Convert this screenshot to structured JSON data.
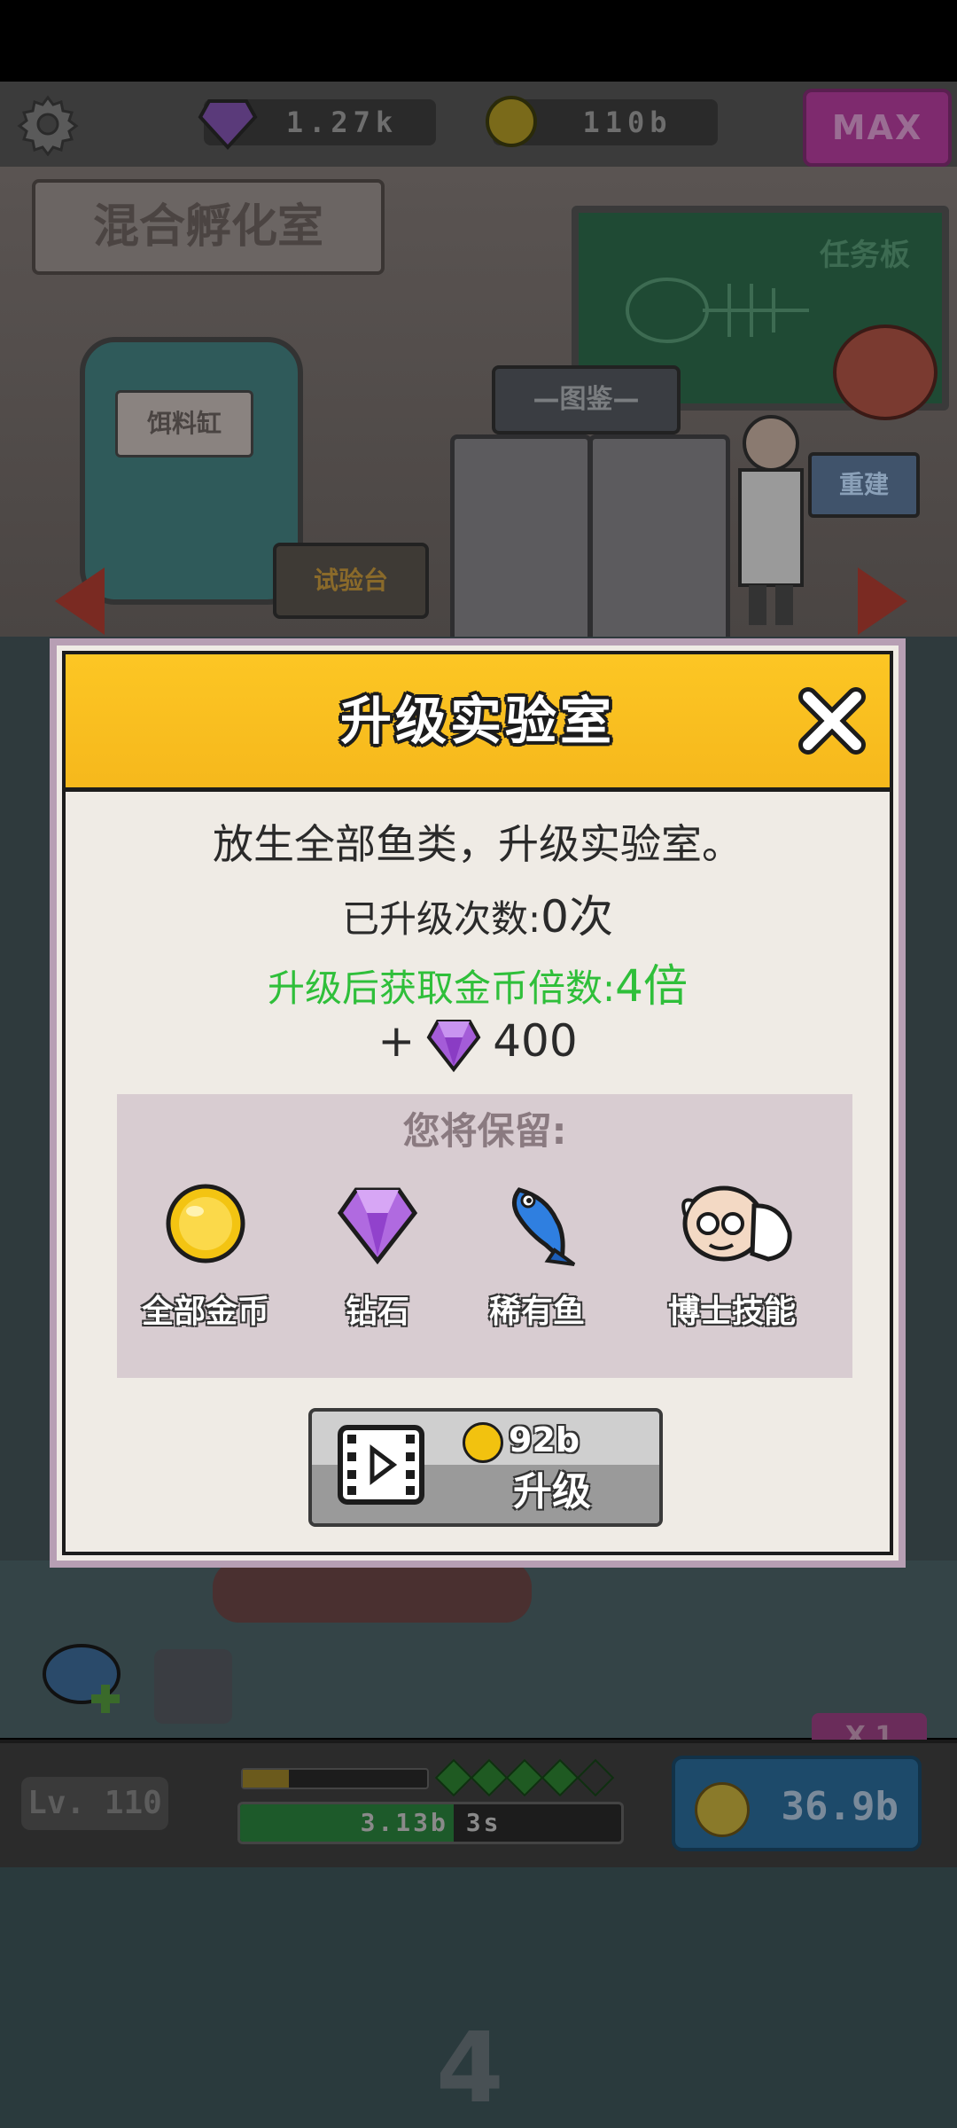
{
  "hud": {
    "gems": "1.27k",
    "coins": "110b",
    "max_label": "MAX"
  },
  "scene": {
    "room_label": "混合孵化室",
    "taskboard_label": "任务板",
    "tank_label": "饵料缸",
    "codex_label": "—图鉴—",
    "testbench_label": "试验台",
    "rebuild_label": "重建"
  },
  "dialog": {
    "title": "升级实验室",
    "description": "放生全部鱼类，升级实验室。",
    "upgrade_count_label": "已升级次数:",
    "upgrade_count_value": "0次",
    "multiplier_label": "升级后获取金币倍数:",
    "multiplier_value": "4倍",
    "gem_reward_prefix": "+",
    "gem_reward": "400",
    "keep_title": "您将保留:",
    "keep_items": [
      {
        "label": "全部金币",
        "icon": "gold-coin-icon"
      },
      {
        "label": "钻石",
        "icon": "diamond-icon"
      },
      {
        "label": "稀有鱼",
        "icon": "rare-fish-icon"
      },
      {
        "label": "博士技能",
        "icon": "doctor-icon"
      }
    ],
    "upgrade_button": {
      "cost": "92b",
      "label": "升级"
    }
  },
  "bottom_hud": {
    "level": "Lv. 110",
    "coin_rate": "3.13b",
    "time": "3s",
    "multiplier": "X 1",
    "coin_button": "36.9b",
    "floor_number": "4",
    "small_progress": 0.25,
    "big_progress": 0.56
  },
  "colors": {
    "header_yellow": "#fcc624",
    "green_text": "#2fbf3a",
    "dialog_bg": "#efebe5",
    "keep_panel": "#d8ccd1"
  }
}
